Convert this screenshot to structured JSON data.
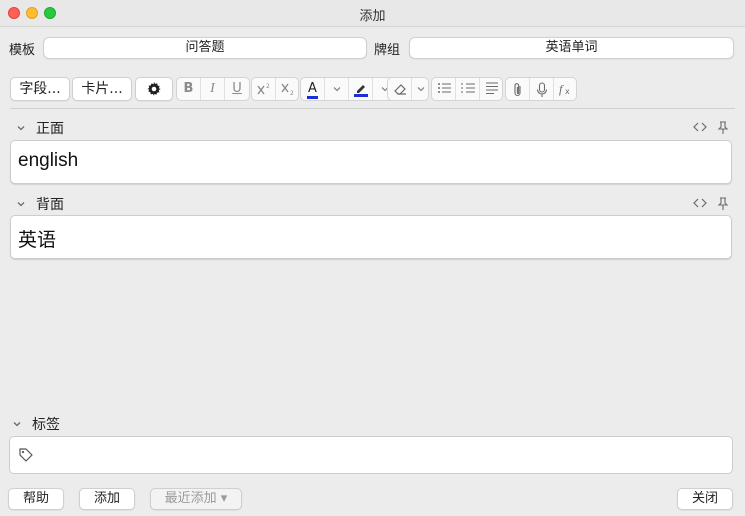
{
  "window": {
    "title": "添加"
  },
  "top_row": {
    "notetype_label": "模板",
    "notetype_value": "问答题",
    "deck_label": "牌组",
    "deck_value": "英语单词"
  },
  "toolbar": {
    "fields_button": "字段...",
    "cards_button": "卡片...",
    "bold": "B",
    "italic": "I",
    "underline": "U",
    "text_color_letter": "A",
    "text_color": "#1b2fd8",
    "highlight_color": "#1b2fd8"
  },
  "fields": [
    {
      "name": "正面",
      "value": "english"
    },
    {
      "name": "背面",
      "value": "英语"
    }
  ],
  "tags": {
    "label": "标签"
  },
  "bottom": {
    "help": "帮助",
    "add": "添加",
    "history": "最近添加 ▾",
    "close": "关闭"
  }
}
